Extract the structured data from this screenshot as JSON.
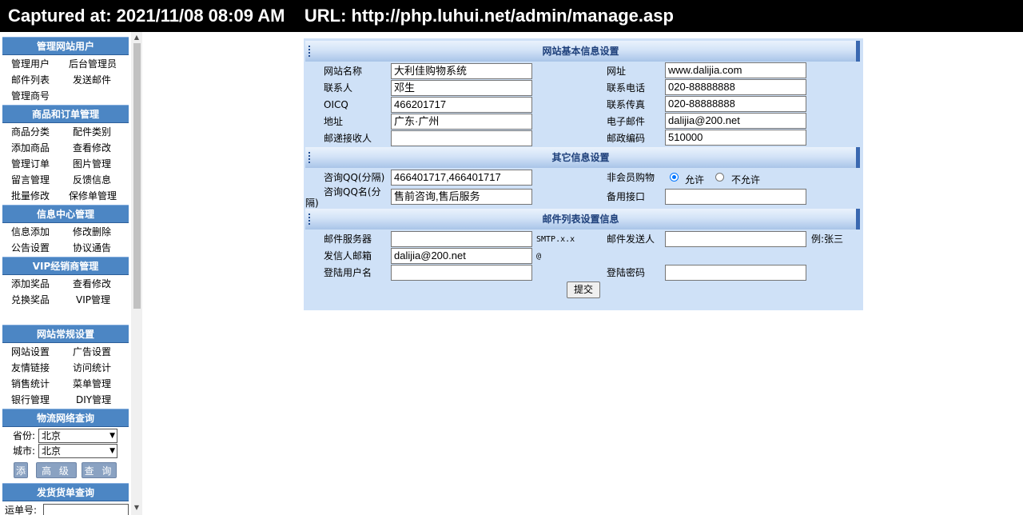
{
  "capture_bar": {
    "text": "Captured at: 2021/11/08 08:09 AM    URL: http://php.luhui.net/admin/manage.asp"
  },
  "sidebar": {
    "groups": [
      {
        "title": "管理网站用户",
        "links": [
          "管理用户",
          "后台管理员",
          "邮件列表",
          "发送邮件",
          "管理商号"
        ]
      },
      {
        "title": "商品和订单管理",
        "links": [
          "商品分类",
          "配件类别",
          "添加商品",
          "查看修改",
          "管理订单",
          "图片管理",
          "留言管理",
          "反馈信息",
          "批量修改",
          "保修单管理"
        ]
      },
      {
        "title": "信息中心管理",
        "links": [
          "信息添加",
          "修改删除",
          "公告设置",
          "协议通告"
        ]
      },
      {
        "title": "VIP经销商管理",
        "links": [
          "添加奖品",
          "查看修改",
          "兑换奖品",
          "VIP管理"
        ]
      },
      {
        "title": "网站常规设置",
        "links": [
          "网站设置",
          "广告设置",
          "友情链接",
          "访问统计",
          "销售统计",
          "菜单管理",
          "银行管理",
          "DIY管理"
        ]
      }
    ],
    "logistics": {
      "title": "物流网络查询",
      "province_label": "省份:",
      "province_value": "北京",
      "city_label": "城市:",
      "city_value": "北京",
      "buttons": [
        "添",
        "高 级",
        "查 询"
      ]
    },
    "shipping": {
      "title": "发货货单查询",
      "waybill_label": "运单号:"
    }
  },
  "form": {
    "sections": [
      "网站基本信息设置",
      "其它信息设置",
      "邮件列表设置信息"
    ],
    "basic": {
      "site_name_label": "网站名称",
      "site_name": "大利佳购物系统",
      "url_label": "网址",
      "url": "www.dalijia.com",
      "contact_label": "联系人",
      "contact": "邓生",
      "phone_label": "联系电话",
      "phone": "020-88888888",
      "oicq_label": "OICQ",
      "oicq": "466201717",
      "fax_label": "联系传真",
      "fax": "020-88888888",
      "address_label": "地址",
      "address": "广东·广州",
      "email_label": "电子邮件",
      "email": "dalijia@200.net",
      "recipient_label": "邮递接收人",
      "recipient": "",
      "zip_label": "邮政编码",
      "zip": "510000"
    },
    "other": {
      "qq_label": "咨询QQ(分隔)",
      "qq": "466401717,466401717",
      "guest_label": "非会员购物",
      "allow_label": "允许",
      "deny_label": "不允许",
      "qq_name_label_1": "咨询QQ名(分",
      "qq_name_label_2": "隔)",
      "qq_name": "售前咨询,售后服务",
      "backup_label": "备用接口",
      "backup": ""
    },
    "mail": {
      "server_label": "邮件服务器",
      "server": "",
      "server_note": "SMTP.x.x",
      "sender_label": "邮件发送人",
      "sender": "",
      "sender_note": "例:张三",
      "from_label": "发信人邮箱",
      "from": "dalijia@200.net",
      "from_note": "@",
      "login_label": "登陆用户名",
      "login": "",
      "password_label": "登陆密码",
      "password": ""
    },
    "submit_label": "提交"
  }
}
